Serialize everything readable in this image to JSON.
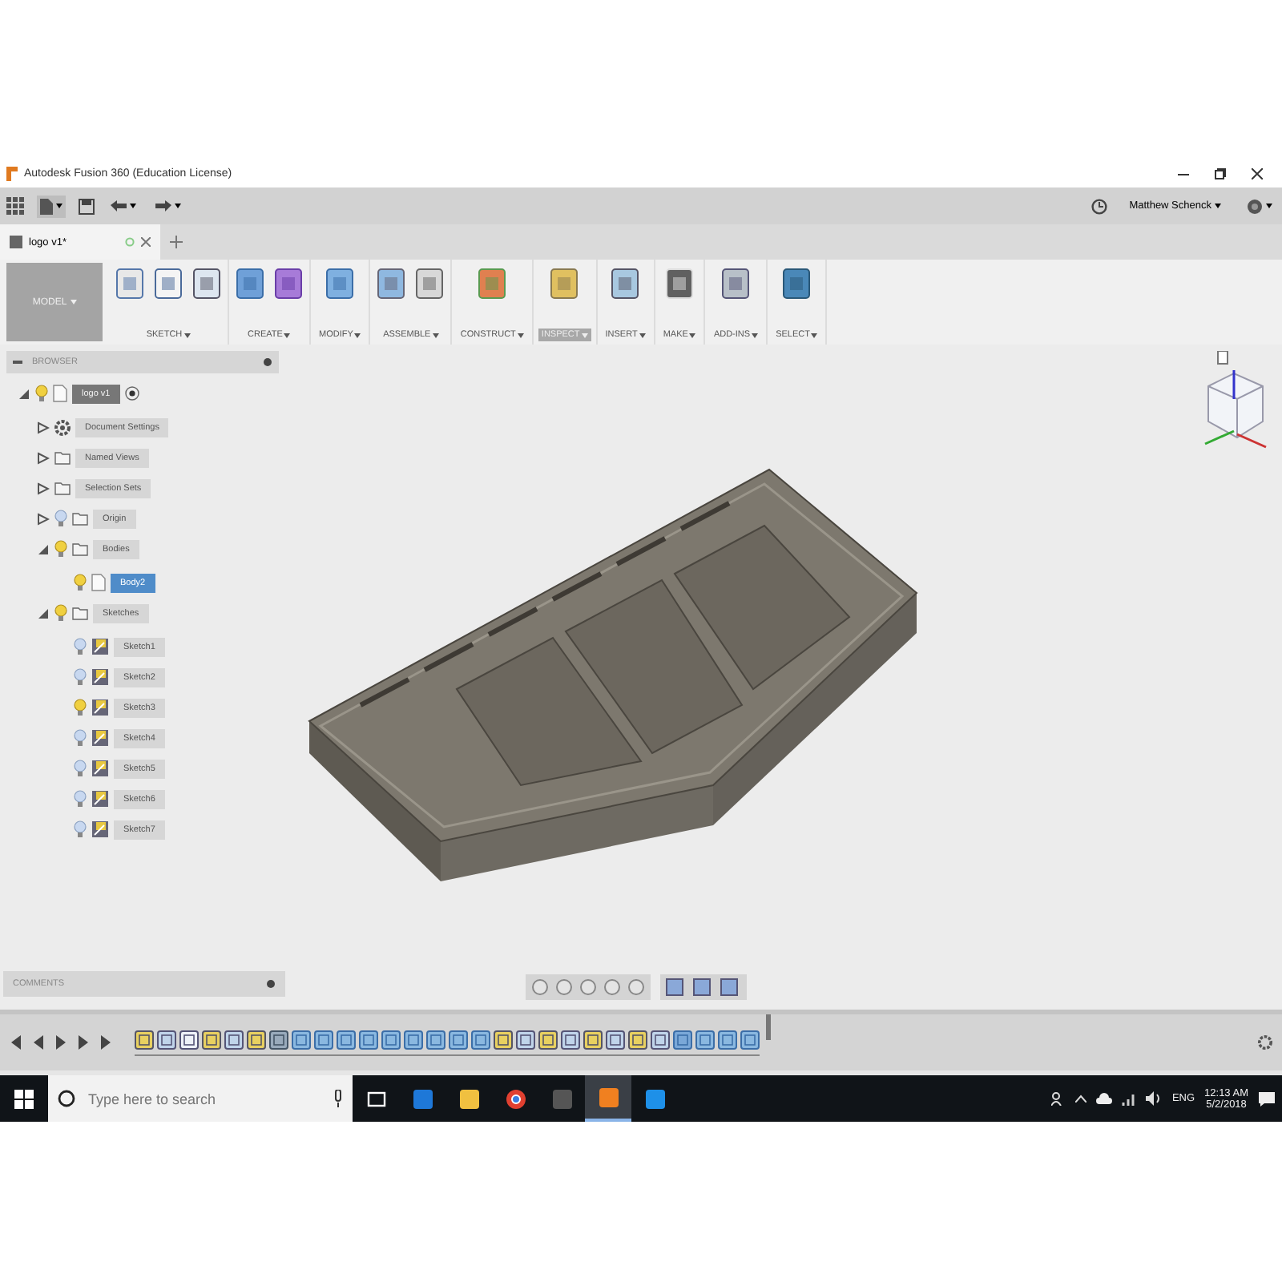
{
  "window": {
    "title": "Autodesk Fusion 360 (Education License)"
  },
  "toolbar": {
    "user": "Matthew Schenck"
  },
  "tabs": [
    {
      "label": "logo v1*",
      "selected": true
    }
  ],
  "ribbon": {
    "workspace": "MODEL",
    "groups": [
      {
        "label": "SKETCH",
        "selected": false,
        "tools": [
          {
            "kind": "sketch"
          },
          {
            "kind": "arc"
          },
          {
            "kind": "rectangle"
          }
        ]
      },
      {
        "label": "CREATE",
        "selected": false,
        "tools": [
          {
            "kind": "box"
          },
          {
            "kind": "grid"
          }
        ]
      },
      {
        "label": "MODIFY",
        "selected": false,
        "tools": [
          {
            "kind": "pushpull"
          }
        ]
      },
      {
        "label": "ASSEMBLE",
        "selected": false,
        "tools": [
          {
            "kind": "component"
          },
          {
            "kind": "joint"
          }
        ]
      },
      {
        "label": "CONSTRUCT",
        "selected": false,
        "tools": [
          {
            "kind": "plane"
          }
        ]
      },
      {
        "label": "INSPECT",
        "selected": true,
        "tools": [
          {
            "kind": "measure"
          }
        ]
      },
      {
        "label": "INSERT",
        "selected": false,
        "tools": [
          {
            "kind": "image"
          }
        ]
      },
      {
        "label": "MAKE",
        "selected": false,
        "tools": [
          {
            "kind": "print"
          }
        ]
      },
      {
        "label": "ADD-INS",
        "selected": false,
        "tools": [
          {
            "kind": "addin"
          }
        ]
      },
      {
        "label": "SELECT",
        "selected": false,
        "tools": [
          {
            "kind": "select"
          }
        ]
      }
    ]
  },
  "browser": {
    "title": "BROWSER",
    "tree": [
      {
        "label": "logo v1",
        "kind": "root",
        "expanded": true,
        "visible": true,
        "selected": false,
        "children": [
          {
            "label": "Document Settings",
            "kind": "settings",
            "expanded": false,
            "selected": false
          },
          {
            "label": "Named Views",
            "kind": "folder",
            "expanded": false,
            "selected": false
          },
          {
            "label": "Selection Sets",
            "kind": "folder",
            "expanded": false,
            "selected": false
          },
          {
            "label": "Origin",
            "kind": "folder",
            "expanded": false,
            "visible": false,
            "selected": false
          },
          {
            "label": "Bodies",
            "kind": "folder",
            "expanded": true,
            "visible": true,
            "selected": false,
            "children": [
              {
                "label": "Body2",
                "kind": "body",
                "visible": true,
                "selected": true
              }
            ]
          },
          {
            "label": "Sketches",
            "kind": "folder",
            "expanded": true,
            "visible": true,
            "selected": false,
            "children": [
              {
                "label": "Sketch1",
                "kind": "sketch",
                "visible": false,
                "selected": false
              },
              {
                "label": "Sketch2",
                "kind": "sketch",
                "visible": false,
                "selected": false
              },
              {
                "label": "Sketch3",
                "kind": "sketch",
                "visible": true,
                "selected": false
              },
              {
                "label": "Sketch4",
                "kind": "sketch",
                "visible": false,
                "selected": false
              },
              {
                "label": "Sketch5",
                "kind": "sketch",
                "visible": false,
                "selected": false
              },
              {
                "label": "Sketch6",
                "kind": "sketch",
                "visible": false,
                "selected": false
              },
              {
                "label": "Sketch7",
                "kind": "sketch",
                "visible": false,
                "selected": false
              }
            ]
          }
        ]
      }
    ]
  },
  "comments": {
    "title": "COMMENTS"
  },
  "timeline": {
    "features": [
      {
        "kind": "sketch"
      },
      {
        "kind": "extrude"
      },
      {
        "kind": "plane"
      },
      {
        "kind": "sketch"
      },
      {
        "kind": "extrude"
      },
      {
        "kind": "sketch"
      },
      {
        "kind": "move"
      },
      {
        "kind": "body"
      },
      {
        "kind": "body"
      },
      {
        "kind": "body"
      },
      {
        "kind": "body"
      },
      {
        "kind": "body"
      },
      {
        "kind": "body"
      },
      {
        "kind": "body"
      },
      {
        "kind": "body"
      },
      {
        "kind": "body"
      },
      {
        "kind": "sketch"
      },
      {
        "kind": "extrude"
      },
      {
        "kind": "sketch"
      },
      {
        "kind": "extrude"
      },
      {
        "kind": "sketch"
      },
      {
        "kind": "extrude"
      },
      {
        "kind": "sketch"
      },
      {
        "kind": "extrude"
      },
      {
        "kind": "combine"
      },
      {
        "kind": "body"
      },
      {
        "kind": "body"
      },
      {
        "kind": "body"
      }
    ]
  },
  "taskbar": {
    "search": {
      "placeholder": "Type here to search"
    },
    "apps": [
      {
        "kind": "taskview",
        "active": false
      },
      {
        "kind": "edge",
        "active": false
      },
      {
        "kind": "explorer",
        "active": false
      },
      {
        "kind": "chrome",
        "active": false
      },
      {
        "kind": "terminal",
        "active": false
      },
      {
        "kind": "fusion",
        "active": true
      },
      {
        "kind": "c",
        "active": false
      }
    ],
    "language": "ENG",
    "time": "12:13 AM",
    "date": "5/2/2018"
  }
}
